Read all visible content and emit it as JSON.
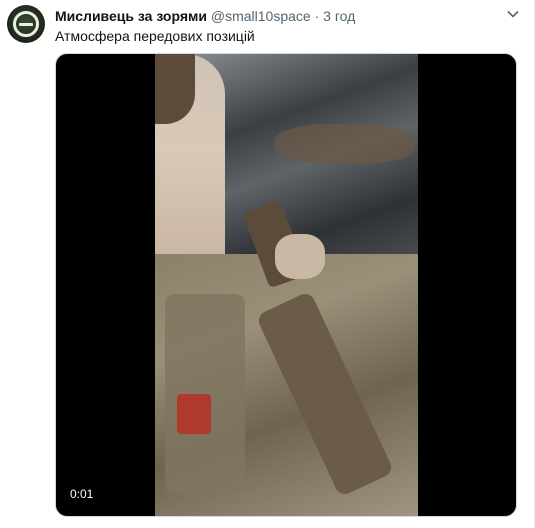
{
  "tweet": {
    "display_name": "Мисливець за зорями",
    "handle": "@small10space",
    "separator": "·",
    "time": "3 год",
    "text": "Атмосфера передових позицій",
    "menu_icon": "chevron-down-icon"
  },
  "avatar": {
    "icon": "theta-logo-icon"
  },
  "video": {
    "timecode": "0:01"
  },
  "colors": {
    "text_primary": "#0f1419",
    "text_secondary": "#536471",
    "media_background": "#000000"
  }
}
